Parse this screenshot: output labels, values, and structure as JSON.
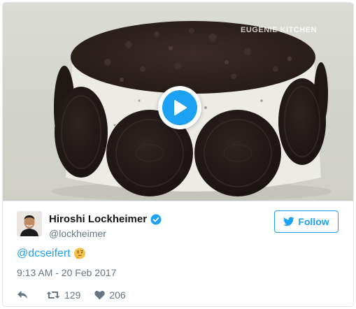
{
  "media": {
    "watermark": "EUGENIE KITCHEN",
    "play_icon": "play-icon"
  },
  "author": {
    "display_name": "Hiroshi Lockheimer",
    "screen_name": "@lockheimer",
    "verified_icon": "verified-badge-icon"
  },
  "follow": {
    "label": "Follow",
    "icon": "twitter-bird-icon"
  },
  "tweet": {
    "text": "@dcseifert",
    "emoji": "thinking-face-icon",
    "timestamp": "9:13 AM - 20 Feb 2017"
  },
  "actions": {
    "reply_icon": "reply-icon",
    "retweet_icon": "retweet-icon",
    "retweet_count": "129",
    "like_icon": "heart-icon",
    "like_count": "206"
  },
  "colors": {
    "accent": "#1da1f2",
    "secondary_text": "#657786",
    "border": "#e1e8ed"
  }
}
